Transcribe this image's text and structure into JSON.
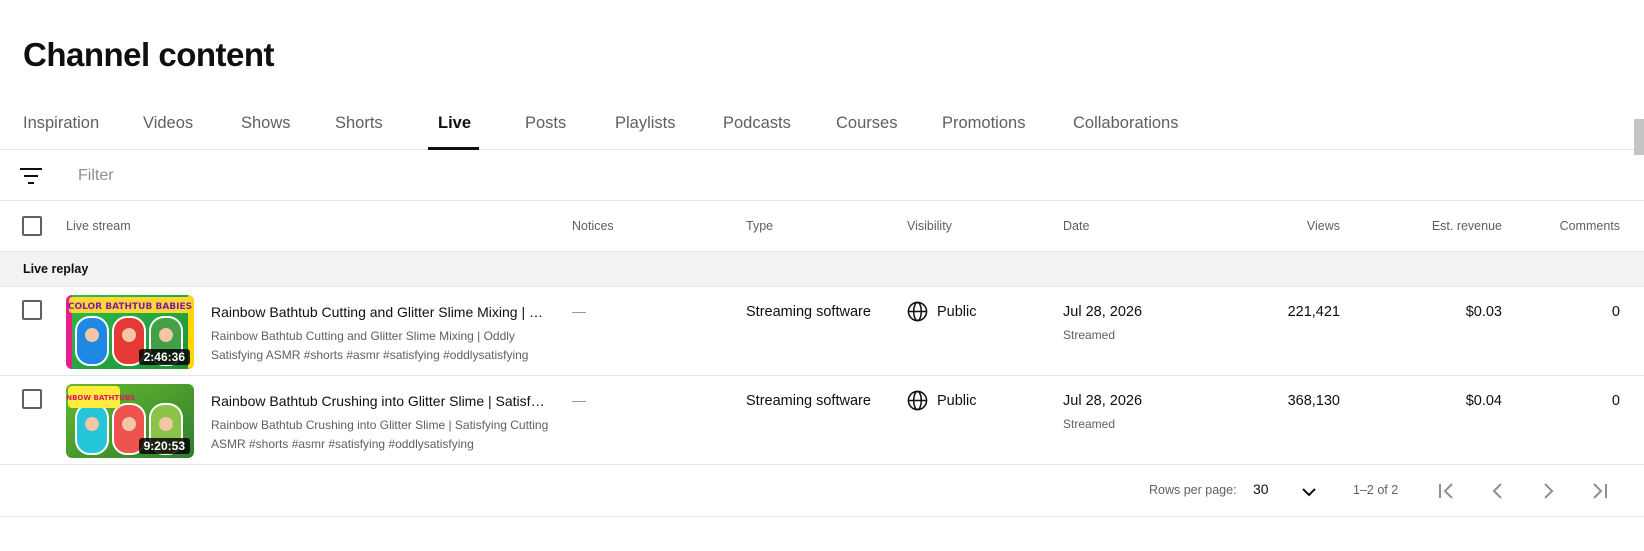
{
  "page": {
    "title": "Channel content"
  },
  "tabs": [
    {
      "label": "Inspiration"
    },
    {
      "label": "Videos"
    },
    {
      "label": "Shows"
    },
    {
      "label": "Shorts"
    },
    {
      "label": "Live",
      "active": true
    },
    {
      "label": "Posts"
    },
    {
      "label": "Playlists"
    },
    {
      "label": "Podcasts"
    },
    {
      "label": "Courses"
    },
    {
      "label": "Promotions"
    },
    {
      "label": "Collaborations"
    }
  ],
  "filter": {
    "icon": "filter-icon",
    "placeholder": "Filter"
  },
  "table": {
    "headers": {
      "live_stream": "Live stream",
      "notices": "Notices",
      "type": "Type",
      "visibility": "Visibility",
      "date": "Date",
      "views": "Views",
      "revenue": "Est. revenue",
      "comments": "Comments"
    },
    "group_label": "Live replay",
    "rows": [
      {
        "title": "Rainbow Bathtub Cutting and Glitter Slime Mixing | Oddly Satisfying ASMR",
        "description": "Rainbow Bathtub Cutting and Glitter Slime Mixing | Oddly Satisfying ASMR #shorts #asmr #satisfying #oddlysatisfying",
        "thumbnail_text": "COLOR BATHTUB BABIES",
        "duration": "2:46:36",
        "notice": "—",
        "type": "Streaming software",
        "visibility": "Public",
        "visibility_icon": "globe-icon",
        "date": "Jul 28, 2026",
        "date_status": "Streamed",
        "views": "221,421",
        "revenue": "$0.03",
        "comments": "0"
      },
      {
        "title": "Rainbow Bathtub Crushing into Glitter Slime | Satisfying Cutting ASMR",
        "description": "Rainbow Bathtub Crushing into Glitter Slime | Satisfying Cutting ASMR #shorts #asmr #satisfying #oddlysatisfying",
        "thumbnail_text": "RAINBOW BATHTUBS",
        "duration": "9:20:53",
        "notice": "—",
        "type": "Streaming software",
        "visibility": "Public",
        "visibility_icon": "globe-icon",
        "date": "Jul 28, 2026",
        "date_status": "Streamed",
        "views": "368,130",
        "revenue": "$0.04",
        "comments": "0"
      }
    ]
  },
  "pagination": {
    "rows_per_page_label": "Rows per page:",
    "rows_per_page": "30",
    "range": "1–2 of 2"
  },
  "colors": {
    "text": "#0f0f0f",
    "secondary": "#606060",
    "divider": "#e5e5e5",
    "group_bg": "#f2f2f2"
  }
}
